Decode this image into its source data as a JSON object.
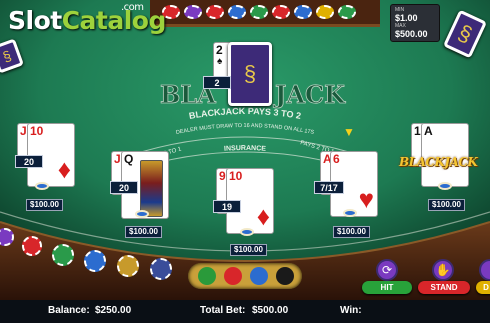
{
  "logo": {
    "slot": "Slot",
    "catalog": "Catalog",
    "dotcom": ".com"
  },
  "limits": {
    "min_label": "MIN",
    "min_value": "$1.00",
    "max_label": "MAX",
    "max_value": "$500.00"
  },
  "table": {
    "title_left": "BLA",
    "title_right": "JACK",
    "pays": "BLACKJACK PAYS 3 TO 2",
    "rule": "DEALER MUST DRAW TO 16 AND STAND ON ALL 17S",
    "insurance": "INSURANCE",
    "ins_left": "PAYS 2 TO 1",
    "ins_right": "PAYS 2 TO 1"
  },
  "dealer": {
    "card_rank": "2",
    "card_suit": "♠",
    "total": "2"
  },
  "hands": [
    {
      "cards": [
        {
          "rank": "J",
          "suit": "♦",
          "color": "red"
        },
        {
          "rank": "10",
          "suit": "♦",
          "color": "red"
        }
      ],
      "total": "20",
      "bet": "$100.00"
    },
    {
      "cards": [
        {
          "rank": "J",
          "suit": "♦",
          "color": "red"
        },
        {
          "rank": "Q",
          "suit": "♠",
          "color": "black"
        }
      ],
      "total": "20",
      "bet": "$100.00"
    },
    {
      "cards": [
        {
          "rank": "9",
          "suit": "♦",
          "color": "red"
        },
        {
          "rank": "10",
          "suit": "♦",
          "color": "red"
        }
      ],
      "total": "19",
      "bet": "$100.00"
    },
    {
      "cards": [
        {
          "rank": "A",
          "suit": "♥",
          "color": "red"
        },
        {
          "rank": "6",
          "suit": "♥",
          "color": "red"
        }
      ],
      "total": "7/17",
      "bet": "$100.00"
    },
    {
      "cards": [
        {
          "rank": "10",
          "suit": "♠",
          "color": "black"
        },
        {
          "rank": "A",
          "suit": "♠",
          "color": "black"
        }
      ],
      "badge": "BLACKJACK",
      "bet": "$100.00"
    }
  ],
  "buttons": {
    "hit": "HIT",
    "stand": "STAND",
    "double": "D"
  },
  "status": {
    "balance_label": "Balance:",
    "balance": "$250.00",
    "total_bet_label": "Total Bet:",
    "total_bet": "$500.00",
    "win_label": "Win:",
    "win": ""
  },
  "colors": {
    "felt": "#1d7a52",
    "felt_dark": "#0f4a32",
    "rail": "#3a1d0f",
    "gold": "#f4d01a"
  }
}
